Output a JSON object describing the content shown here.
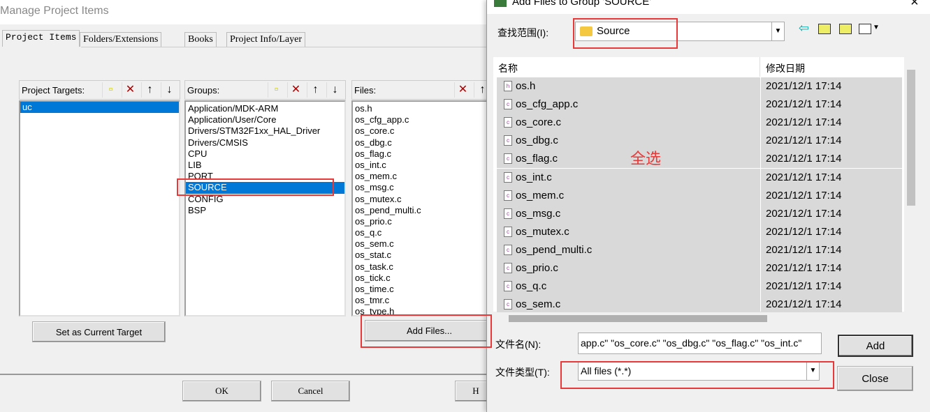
{
  "main_dialog": {
    "title": "Manage Project Items",
    "tabs": [
      "Project Items",
      "Folders/Extensions",
      "Books",
      "Project Info/Layer"
    ],
    "targets": {
      "label": "Project Targets:",
      "items": [
        "uc"
      ],
      "selected": "uc"
    },
    "groups": {
      "label": "Groups:",
      "items": [
        "Application/MDK-ARM",
        "Application/User/Core",
        "Drivers/STM32F1xx_HAL_Driver",
        "Drivers/CMSIS",
        "CPU",
        "LIB",
        "PORT",
        "SOURCE",
        "CONFIG",
        "BSP"
      ],
      "selected": "SOURCE"
    },
    "files": {
      "label": "Files:",
      "items": [
        "os.h",
        "os_cfg_app.c",
        "os_core.c",
        "os_dbg.c",
        "os_flag.c",
        "os_int.c",
        "os_mem.c",
        "os_msg.c",
        "os_mutex.c",
        "os_pend_multi.c",
        "os_prio.c",
        "os_q.c",
        "os_sem.c",
        "os_stat.c",
        "os_task.c",
        "os_tick.c",
        "os_time.c",
        "os_tmr.c",
        "os_type.h"
      ]
    },
    "set_target_button": "Set as Current Target",
    "add_files_button": "Add Files...",
    "ok_button": "OK",
    "cancel_button": "Cancel",
    "help_button": "H"
  },
  "file_dialog": {
    "title": "Add Files to Group 'SOURCE'",
    "look_in_label": "查找范围(I):",
    "look_in_value": "Source",
    "columns": [
      "名称",
      "修改日期"
    ],
    "rows": [
      {
        "name": "os.h",
        "date": "2021/12/1 17:14",
        "type": "h"
      },
      {
        "name": "os_cfg_app.c",
        "date": "2021/12/1 17:14",
        "type": "c"
      },
      {
        "name": "os_core.c",
        "date": "2021/12/1 17:14",
        "type": "c"
      },
      {
        "name": "os_dbg.c",
        "date": "2021/12/1 17:14",
        "type": "c"
      },
      {
        "name": "os_flag.c",
        "date": "2021/12/1 17:14",
        "type": "c"
      },
      {
        "name": "os_int.c",
        "date": "2021/12/1 17:14",
        "type": "c"
      },
      {
        "name": "os_mem.c",
        "date": "2021/12/1 17:14",
        "type": "c"
      },
      {
        "name": "os_msg.c",
        "date": "2021/12/1 17:14",
        "type": "c"
      },
      {
        "name": "os_mutex.c",
        "date": "2021/12/1 17:14",
        "type": "c"
      },
      {
        "name": "os_pend_multi.c",
        "date": "2021/12/1 17:14",
        "type": "c"
      },
      {
        "name": "os_prio.c",
        "date": "2021/12/1 17:14",
        "type": "c"
      },
      {
        "name": "os_q.c",
        "date": "2021/12/1 17:14",
        "type": "c"
      },
      {
        "name": "os_sem.c",
        "date": "2021/12/1 17:14",
        "type": "c"
      }
    ],
    "filename_label": "文件名(N):",
    "filename_value": "app.c\" \"os_core.c\" \"os_dbg.c\" \"os_flag.c\" \"os_int.c\"",
    "filetype_label": "文件类型(T):",
    "filetype_value": "All files (*.*)",
    "add_button": "Add",
    "close_button": "Close",
    "close_icon": "×"
  },
  "annotation": {
    "text": "全选",
    "color": "#e83838"
  }
}
